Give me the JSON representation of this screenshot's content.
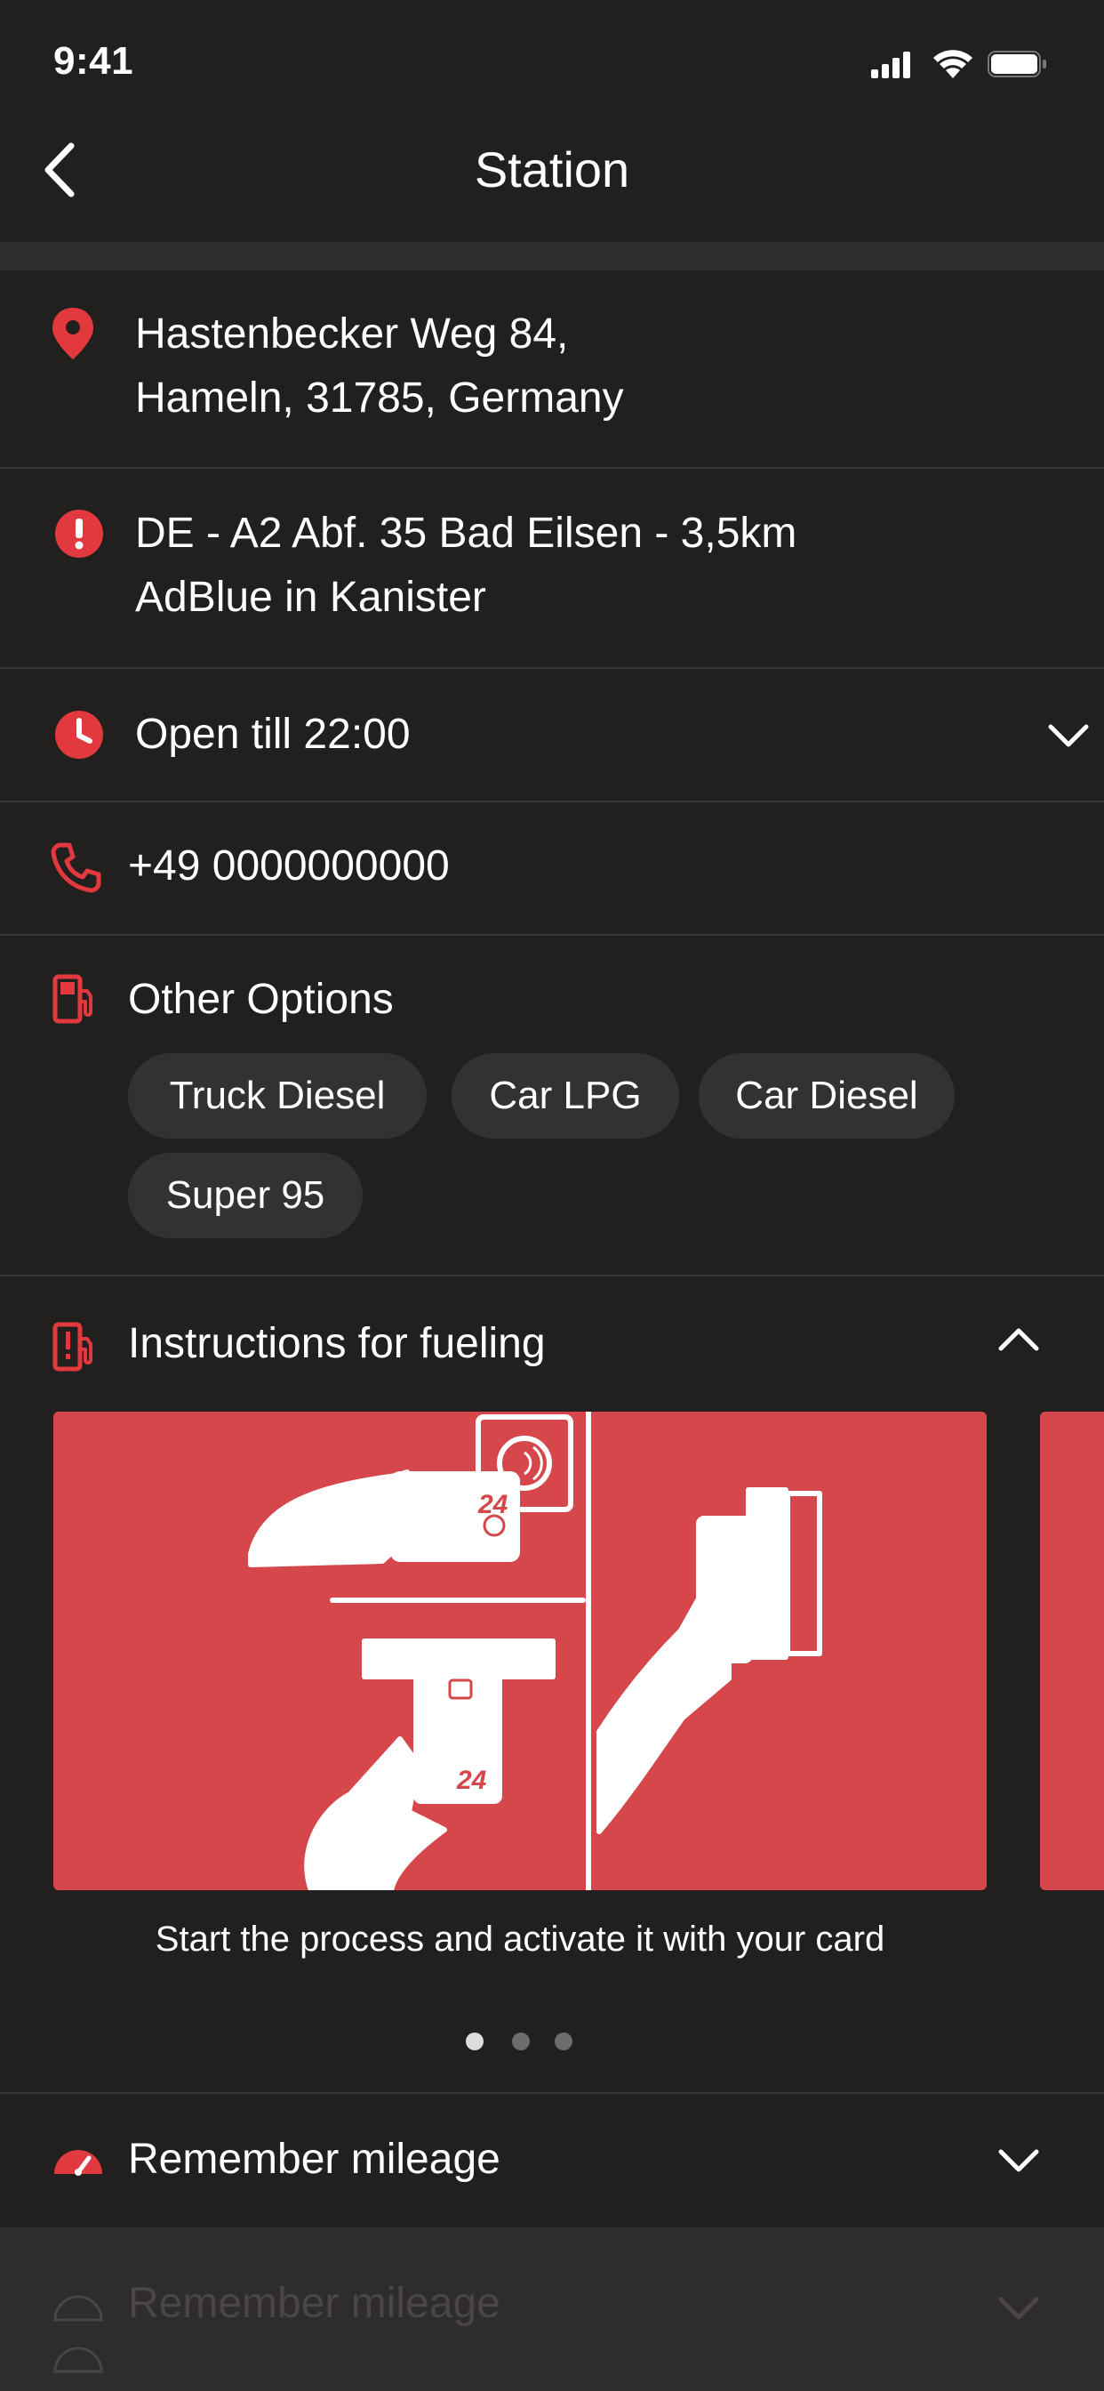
{
  "status_bar": {
    "time": "9:41"
  },
  "nav": {
    "title": "Station"
  },
  "address": {
    "line1": "Hastenbecker Weg 84,",
    "line2": "Hameln, 31785, Germany"
  },
  "notice": {
    "line1": "DE - A2 Abf. 35 Bad Eilsen - 3,5km",
    "line2": "AdBlue in Kanister"
  },
  "hours": {
    "label": "Open till 22:00"
  },
  "phone": {
    "number": "+49 0000000000"
  },
  "other_options": {
    "title": "Other Options",
    "chips": [
      "Truck Diesel",
      "Car LPG",
      "Car Diesel",
      "Super 95"
    ]
  },
  "instructions": {
    "title": "Instructions for fueling",
    "caption": "Start the process and activate it with your card",
    "card_brand": "24",
    "page_count": 3,
    "current_page": 1
  },
  "mileage": {
    "title": "Remember mileage",
    "ghost_title": "Remember mileage"
  },
  "colors": {
    "background": "#221f1f",
    "accent": "#e2393f",
    "card": "#d5474b",
    "chip": "#343131"
  }
}
